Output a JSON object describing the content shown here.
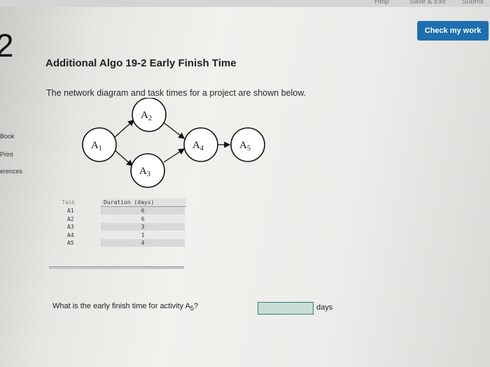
{
  "top_nav": {
    "help_label": "Help",
    "save_exit_label": "Save & Exit",
    "submit_label": "Submit"
  },
  "question_number": "2",
  "check_button_label": "Check my work",
  "sidebar": {
    "items": [
      {
        "label": "Book"
      },
      {
        "label": "Print"
      },
      {
        "label": "erences"
      }
    ]
  },
  "question": {
    "title": "Additional Algo 19-2 Early Finish Time",
    "intro": "The network diagram and task times for a project are shown below."
  },
  "diagram": {
    "nodes": [
      {
        "id": "A1"
      },
      {
        "id": "A2"
      },
      {
        "id": "A3"
      },
      {
        "id": "A4"
      },
      {
        "id": "A5"
      }
    ],
    "edges": [
      [
        "A1",
        "A2"
      ],
      [
        "A1",
        "A3"
      ],
      [
        "A2",
        "A4"
      ],
      [
        "A3",
        "A4"
      ],
      [
        "A4",
        "A5"
      ]
    ]
  },
  "table": {
    "headers": {
      "task": "Task",
      "duration": "Duration (days)"
    },
    "rows": [
      {
        "task": "A1",
        "duration": "6"
      },
      {
        "task": "A2",
        "duration": "6"
      },
      {
        "task": "A3",
        "duration": "3"
      },
      {
        "task": "A4",
        "duration": "1"
      },
      {
        "task": "A5",
        "duration": "4"
      }
    ]
  },
  "prompt": {
    "text_before": "What is the early finish time for activity A",
    "subscript": "5",
    "text_after": "?"
  },
  "answer": {
    "value": "",
    "unit": "days"
  }
}
